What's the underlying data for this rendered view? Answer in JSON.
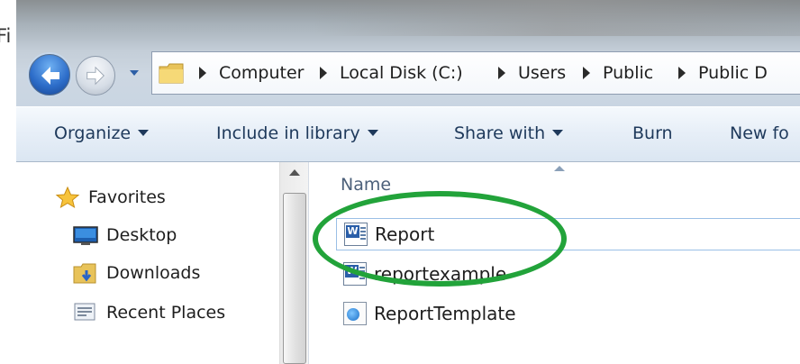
{
  "outer": {
    "partial_text": "Fi"
  },
  "nav": {
    "back": "back-button",
    "forward": "forward-button",
    "recent": "recent-pages-dropdown"
  },
  "address": {
    "crumbs": [
      "Computer",
      "Local Disk (C:)",
      "Users",
      "Public",
      "Public D"
    ]
  },
  "commands": {
    "organize": "Organize",
    "include": "Include in library",
    "share": "Share with",
    "burn": "Burn",
    "newfolder": "New fo"
  },
  "navpane": {
    "favorites": "Favorites",
    "items": [
      "Desktop",
      "Downloads",
      "Recent Places"
    ]
  },
  "filelist": {
    "column_name": "Name",
    "files": [
      {
        "name": "Report",
        "icon": "word-doc-icon",
        "selected": true
      },
      {
        "name": "reportexample",
        "icon": "word-doc-icon",
        "selected": false
      },
      {
        "name": "ReportTemplate",
        "icon": "web-template-icon",
        "selected": false
      }
    ]
  },
  "colors": {
    "highlight": "#22a33a",
    "command_text": "#1e395b",
    "header_text": "#4c607a"
  }
}
